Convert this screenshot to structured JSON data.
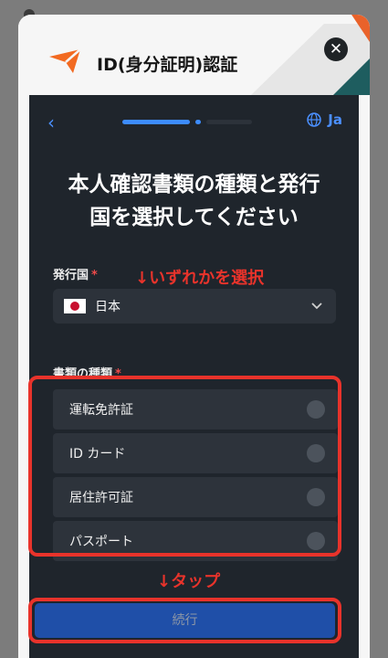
{
  "header": {
    "title": "ID(身分証明)認証"
  },
  "nav": {
    "back_symbol": "‹",
    "language": "Ja",
    "progress": {
      "current_step": 1,
      "total_steps": 2
    }
  },
  "main": {
    "title_line1": "本人確認書類の種類と発行",
    "title_line2": "国を選択してください",
    "country_label": "発行国",
    "required_mark": "*",
    "country_value": "日本",
    "doc_label": "書類の種類",
    "options": [
      "運転免許証",
      "ID カード",
      "居住許可証",
      "パスポート"
    ],
    "continue_label": "続行"
  },
  "annotations": {
    "select_hint": "↓いずれかを選択",
    "tap_hint": "↓タップ"
  },
  "colors": {
    "accent": "#4b90ff",
    "annotation": "#e8332b",
    "panel": "#1f252c",
    "button": "#1f4fa8"
  }
}
